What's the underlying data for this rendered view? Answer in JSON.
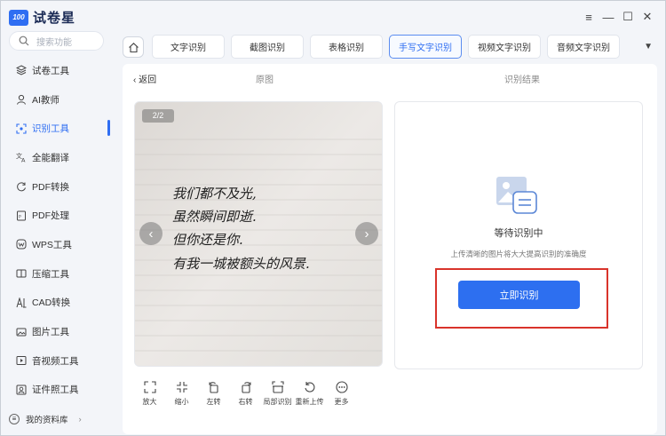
{
  "app": {
    "logo_badge": "100",
    "name": "试卷星"
  },
  "search": {
    "placeholder": "搜索功能"
  },
  "sidebar": {
    "items": [
      {
        "label": "试卷工具",
        "icon": "layers-icon"
      },
      {
        "label": "AI教师",
        "icon": "teacher-icon"
      },
      {
        "label": "识别工具",
        "icon": "scan-icon",
        "active": true
      },
      {
        "label": "全能翻译",
        "icon": "translate-icon"
      },
      {
        "label": "PDF转换",
        "icon": "convert-icon"
      },
      {
        "label": "PDF处理",
        "icon": "pdf-icon"
      },
      {
        "label": "WPS工具",
        "icon": "wps-icon"
      },
      {
        "label": "压缩工具",
        "icon": "compress-icon"
      },
      {
        "label": "CAD转换",
        "icon": "cad-icon"
      },
      {
        "label": "图片工具",
        "icon": "image-icon"
      },
      {
        "label": "音视频工具",
        "icon": "video-icon"
      },
      {
        "label": "证件照工具",
        "icon": "id-photo-icon"
      }
    ],
    "library_label": "我的资料库"
  },
  "tabs": [
    {
      "label": "文字识别"
    },
    {
      "label": "截图识别"
    },
    {
      "label": "表格识别"
    },
    {
      "label": "手写文字识别",
      "active": true
    },
    {
      "label": "视频文字识别"
    },
    {
      "label": "音频文字识别"
    }
  ],
  "main": {
    "back_label": "返回",
    "original_label": "原图",
    "result_label": "识别结果",
    "page_indicator": "2/2",
    "handwriting_lines": [
      "我们都不及光,",
      "虽然瞬间即逝.",
      "但你还是你.",
      "有我一城被额头的风景."
    ],
    "toolbar": [
      {
        "label": "放大",
        "icon": "zoom-in-icon"
      },
      {
        "label": "缩小",
        "icon": "zoom-out-icon"
      },
      {
        "label": "左转",
        "icon": "rotate-left-icon"
      },
      {
        "label": "右转",
        "icon": "rotate-right-icon"
      },
      {
        "label": "局部识别",
        "icon": "partial-recognize-icon"
      },
      {
        "label": "重新上传",
        "icon": "reupload-icon"
      },
      {
        "label": "更多",
        "icon": "more-icon"
      }
    ],
    "result": {
      "status": "等待识别中",
      "tip": "上传清晰的图片将大大提高识别的准确度",
      "button_label": "立即识别"
    }
  },
  "colors": {
    "accent": "#2f6ef2",
    "button": "#2d6ff0",
    "highlight_border": "#d9342b"
  }
}
